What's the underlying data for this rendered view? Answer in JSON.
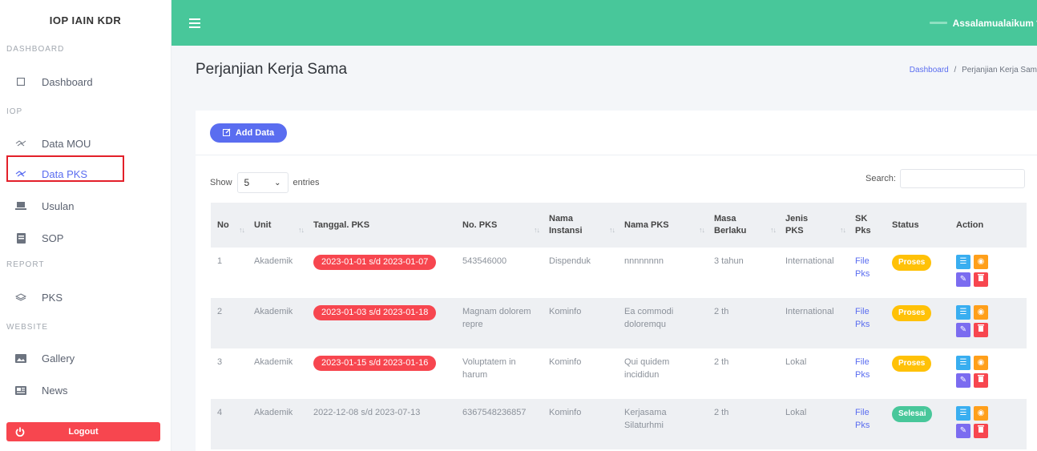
{
  "sidebar": {
    "brand": "IOP IAIN KDR",
    "sections": {
      "dashboard": "DASHBOARD",
      "iop": "IOP",
      "report": "REPORT",
      "website": "WEBSITE"
    },
    "items": {
      "dashboard": "Dashboard",
      "data_mou": "Data MOU",
      "data_pks": "Data PKS",
      "usulan": "Usulan",
      "sop": "SOP",
      "pks": "PKS",
      "gallery": "Gallery",
      "news": "News"
    },
    "logout": "Logout"
  },
  "topbar": {
    "greeting": "Assalamualaikum"
  },
  "page": {
    "title": "Perjanjian Kerja Sama",
    "breadcrumb_home": "Dashboard",
    "breadcrumb_sep": "/",
    "breadcrumb_current": "Perjanjian Kerja Sam"
  },
  "toolbar": {
    "add_label": "Add Data",
    "show_label": "Show",
    "entries_value": "5",
    "entries_label": "entries",
    "search_label": "Search:"
  },
  "table": {
    "headers": {
      "no": "No",
      "unit": "Unit",
      "tanggal": "Tanggal. PKS",
      "no_pks": "No. PKS",
      "instansi_1": "Nama",
      "instansi_2": "Instansi",
      "nama_pks": "Nama PKS",
      "masa_1": "Masa",
      "masa_2": "Berlaku",
      "jenis_1": "Jenis",
      "jenis_2": "PKS",
      "sk_1": "SK",
      "sk_2": "Pks",
      "status": "Status",
      "action": "Action"
    },
    "rows": [
      {
        "no": "1",
        "unit": "Akademik",
        "tanggal": "2023-01-01 s/d 2023-01-07",
        "no_pks": "543546000",
        "instansi": "Dispenduk",
        "nama_pks": "nnnnnnnn",
        "masa": "3 tahun",
        "jenis": "International",
        "sk_1": "File",
        "sk_2": "Pks",
        "status": "Proses"
      },
      {
        "no": "2",
        "unit": "Akademik",
        "tanggal": "2023-01-03 s/d 2023-01-18",
        "no_pks": "Magnam dolorem repre",
        "instansi": "Kominfo",
        "nama_pks": "Ea commodi doloremqu",
        "masa": "2 th",
        "jenis": "International",
        "sk_1": "File",
        "sk_2": "Pks",
        "status": "Proses"
      },
      {
        "no": "3",
        "unit": "Akademik",
        "tanggal": "2023-01-15 s/d 2023-01-16",
        "no_pks": "Voluptatem in harum",
        "instansi": "Kominfo",
        "nama_pks": "Qui quidem incididun",
        "masa": "2 th",
        "jenis": "Lokal",
        "sk_1": "File",
        "sk_2": "Pks",
        "status": "Proses"
      },
      {
        "no": "4",
        "unit": "Akademik",
        "tanggal": "2022-12-08 s/d 2023-07-13",
        "no_pks": "6367548236857",
        "instansi": "Kominfo",
        "nama_pks": "Kerjasama Silaturhmi",
        "masa": "2 th",
        "jenis": "Lokal",
        "sk_1": "File",
        "sk_2": "Pks",
        "status": "Selesai"
      }
    ]
  },
  "colors": {
    "topbar": "#48c79a",
    "primary": "#5a6df0",
    "danger": "#f7464f",
    "warning": "#ffc107",
    "success": "#48c79a"
  }
}
